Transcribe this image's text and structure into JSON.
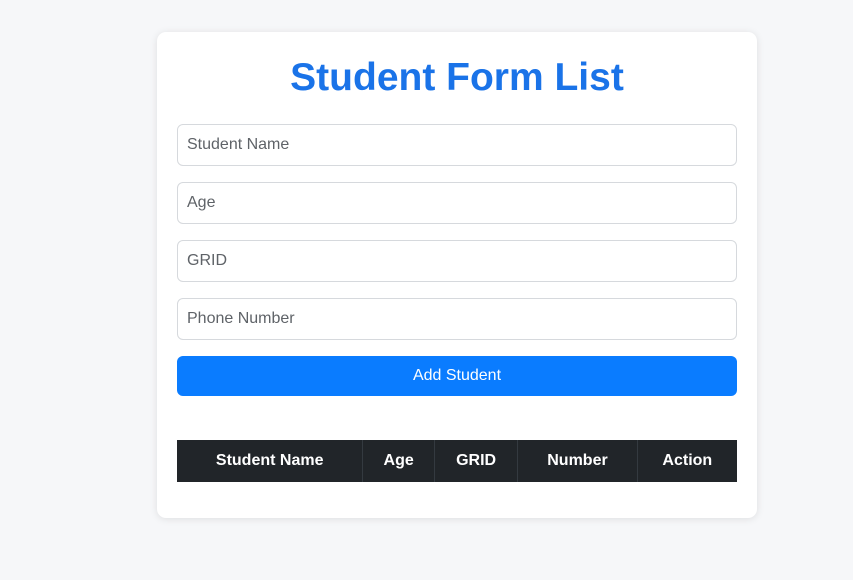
{
  "page": {
    "title": "Student Form List"
  },
  "form": {
    "name_placeholder": "Student Name",
    "age_placeholder": "Age",
    "grid_placeholder": "GRID",
    "phone_placeholder": "Phone Number",
    "name_value": "",
    "age_value": "",
    "grid_value": "",
    "phone_value": "",
    "submit_label": "Add Student"
  },
  "table": {
    "columns": [
      "Student Name",
      "Age",
      "GRID",
      "Number",
      "Action"
    ],
    "rows": []
  },
  "colors": {
    "accent": "#1a73e8",
    "button": "#0a7cff",
    "table_header_bg": "#212529",
    "page_bg": "#f6f7f9"
  }
}
